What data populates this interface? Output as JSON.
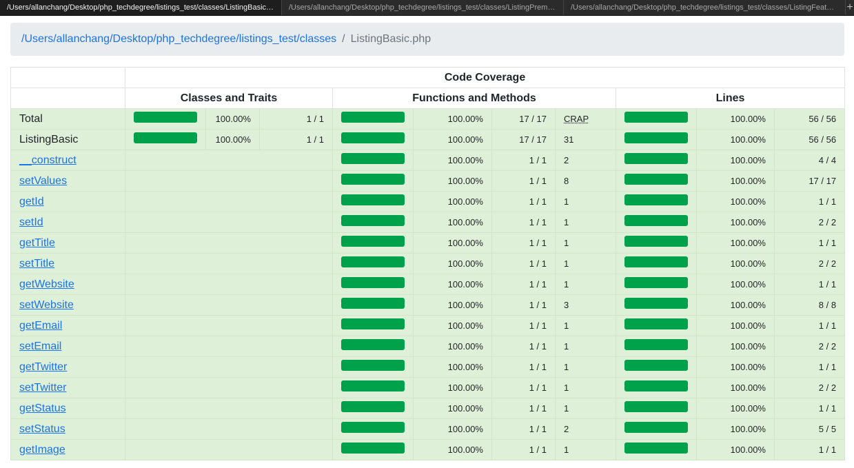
{
  "tabs": [
    {
      "label": "/Users/allanchang/Desktop/php_techdegree/listings_test/classes/ListingBasic.php",
      "active": true
    },
    {
      "label": "/Users/allanchang/Desktop/php_techdegree/listings_test/classes/ListingPremium.php",
      "active": false
    },
    {
      "label": "/Users/allanchang/Desktop/php_techdegree/listings_test/classes/ListingFeatured.php",
      "active": false
    }
  ],
  "new_tab_icon": "+",
  "breadcrumb": {
    "path_link": "/Users/allanchang/Desktop/php_techdegree/listings_test/classes",
    "separator": "/",
    "current": "ListingBasic.php"
  },
  "header": {
    "code_coverage": "Code Coverage",
    "classes_traits": "Classes and Traits",
    "functions_methods": "Functions and Methods",
    "lines": "Lines"
  },
  "colors": {
    "bar": "#00a14b",
    "row_bg": "#dff0d8",
    "link": "#1a73e8"
  },
  "rows": [
    {
      "name": "Total",
      "link": false,
      "cls_pct": "100.00%",
      "cls_count": "1 / 1",
      "fn_pct": "100.00%",
      "fn_count": "17 / 17",
      "crap": "CRAP",
      "ln_pct": "100.00%",
      "ln_count": "56 / 56"
    },
    {
      "name": "ListingBasic",
      "link": false,
      "cls_pct": "100.00%",
      "cls_count": "1 / 1",
      "fn_pct": "100.00%",
      "fn_count": "17 / 17",
      "crap": "31",
      "ln_pct": "100.00%",
      "ln_count": "56 / 56"
    },
    {
      "name": "__construct",
      "link": true,
      "fn_pct": "100.00%",
      "fn_count": "1 / 1",
      "crap": "2",
      "ln_pct": "100.00%",
      "ln_count": "4 / 4"
    },
    {
      "name": "setValues",
      "link": true,
      "fn_pct": "100.00%",
      "fn_count": "1 / 1",
      "crap": "8",
      "ln_pct": "100.00%",
      "ln_count": "17 / 17"
    },
    {
      "name": "getId",
      "link": true,
      "fn_pct": "100.00%",
      "fn_count": "1 / 1",
      "crap": "1",
      "ln_pct": "100.00%",
      "ln_count": "1 / 1"
    },
    {
      "name": "setId",
      "link": true,
      "fn_pct": "100.00%",
      "fn_count": "1 / 1",
      "crap": "1",
      "ln_pct": "100.00%",
      "ln_count": "2 / 2"
    },
    {
      "name": "getTitle",
      "link": true,
      "fn_pct": "100.00%",
      "fn_count": "1 / 1",
      "crap": "1",
      "ln_pct": "100.00%",
      "ln_count": "1 / 1"
    },
    {
      "name": "setTitle",
      "link": true,
      "fn_pct": "100.00%",
      "fn_count": "1 / 1",
      "crap": "1",
      "ln_pct": "100.00%",
      "ln_count": "2 / 2"
    },
    {
      "name": "getWebsite",
      "link": true,
      "fn_pct": "100.00%",
      "fn_count": "1 / 1",
      "crap": "1",
      "ln_pct": "100.00%",
      "ln_count": "1 / 1"
    },
    {
      "name": "setWebsite",
      "link": true,
      "fn_pct": "100.00%",
      "fn_count": "1 / 1",
      "crap": "3",
      "ln_pct": "100.00%",
      "ln_count": "8 / 8"
    },
    {
      "name": "getEmail",
      "link": true,
      "fn_pct": "100.00%",
      "fn_count": "1 / 1",
      "crap": "1",
      "ln_pct": "100.00%",
      "ln_count": "1 / 1"
    },
    {
      "name": "setEmail",
      "link": true,
      "fn_pct": "100.00%",
      "fn_count": "1 / 1",
      "crap": "1",
      "ln_pct": "100.00%",
      "ln_count": "2 / 2"
    },
    {
      "name": "getTwitter",
      "link": true,
      "fn_pct": "100.00%",
      "fn_count": "1 / 1",
      "crap": "1",
      "ln_pct": "100.00%",
      "ln_count": "1 / 1"
    },
    {
      "name": "setTwitter",
      "link": true,
      "fn_pct": "100.00%",
      "fn_count": "1 / 1",
      "crap": "1",
      "ln_pct": "100.00%",
      "ln_count": "2 / 2"
    },
    {
      "name": "getStatus",
      "link": true,
      "fn_pct": "100.00%",
      "fn_count": "1 / 1",
      "crap": "1",
      "ln_pct": "100.00%",
      "ln_count": "1 / 1"
    },
    {
      "name": "setStatus",
      "link": true,
      "fn_pct": "100.00%",
      "fn_count": "1 / 1",
      "crap": "2",
      "ln_pct": "100.00%",
      "ln_count": "5 / 5"
    },
    {
      "name": "getImage",
      "link": true,
      "fn_pct": "100.00%",
      "fn_count": "1 / 1",
      "crap": "1",
      "ln_pct": "100.00%",
      "ln_count": "1 / 1"
    }
  ]
}
